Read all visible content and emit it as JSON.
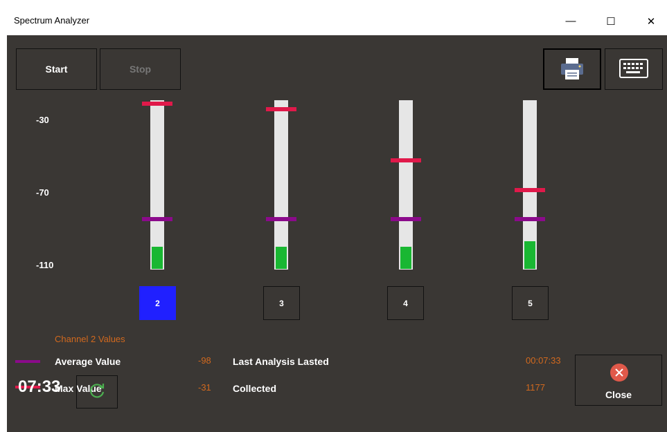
{
  "window": {
    "title": "Spectrum Analyzer",
    "minimize_glyph": "—",
    "maximize_glyph": "☐",
    "close_glyph": "✕"
  },
  "toolbar": {
    "start_label": "Start",
    "stop_label": "Stop",
    "print_icon": "printer-icon",
    "keyboard_icon": "keyboard-icon"
  },
  "scale": {
    "labels": [
      "-30",
      "-70",
      "-110"
    ]
  },
  "channels": [
    {
      "label": "2",
      "selected": true,
      "max": -31,
      "avg": -98,
      "level_fraction": 0.14
    },
    {
      "label": "3",
      "selected": false,
      "max": -34,
      "avg": -98,
      "level_fraction": 0.14
    },
    {
      "label": "4",
      "selected": false,
      "max": -64,
      "avg": -98,
      "level_fraction": 0.14
    },
    {
      "label": "5",
      "selected": false,
      "max": -81,
      "avg": -98,
      "level_fraction": 0.17
    }
  ],
  "info": {
    "section_title": "Channel 2 Values",
    "average_label": "Average Value",
    "average_value": "-98",
    "max_label": "Max Value",
    "max_value": "-31",
    "last_analysis_label": "Last Analysis Lasted",
    "last_analysis_value": "00:07:33",
    "collected_label": "Collected",
    "collected_value": "1177"
  },
  "footer": {
    "clock": "07:33",
    "refresh_icon": "refresh-icon",
    "close_label": "Close",
    "close_icon": "close-circle-icon"
  },
  "colors": {
    "background": "#3a3734",
    "track": "#e6e6e6",
    "level": "#19b732",
    "max_marker": "#e0194a",
    "avg_marker": "#8b0a8b",
    "selected_channel": "#2020ff",
    "value_text": "#d2691e",
    "close_icon": "#e0594a",
    "refresh_icon": "#4caf50"
  }
}
